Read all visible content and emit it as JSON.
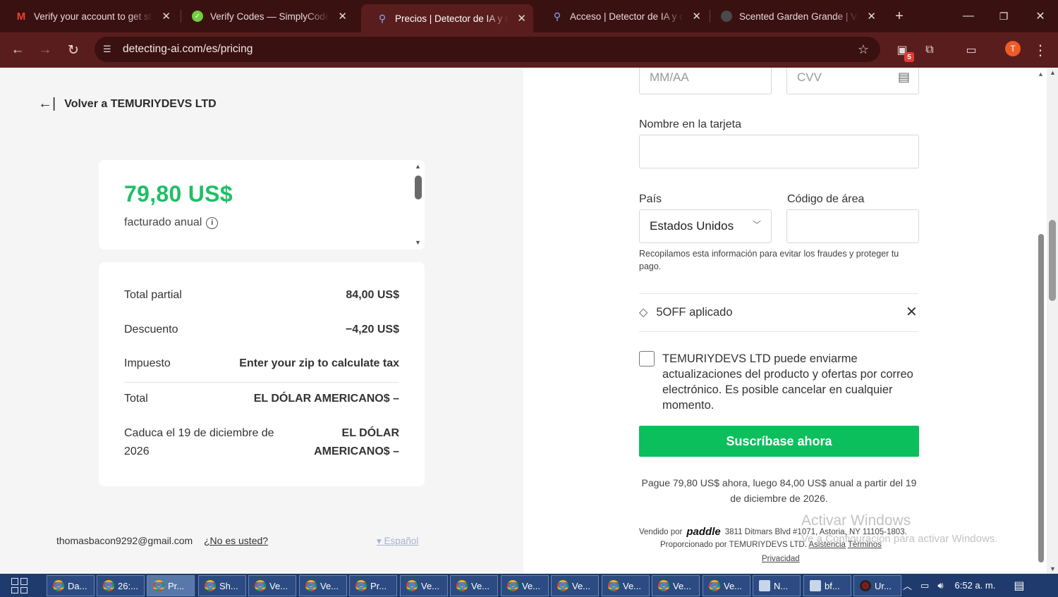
{
  "browser": {
    "tabs": [
      {
        "title": "Verify your account to get sta",
        "icon": "gmail-icon",
        "color": "#d93025"
      },
      {
        "title": "Verify Codes — SimplyCodes",
        "icon": "simplycodes-icon",
        "color": "#6fcf3f"
      },
      {
        "title": "Precios | Detector de IA y con",
        "icon": "search-magnifier-icon",
        "color": "#8aa4ff"
      },
      {
        "title": "Acceso | Detector de IA y con",
        "icon": "search-magnifier-icon",
        "color": "#8aa4ff"
      },
      {
        "title": "Scented Garden Grande | Val",
        "icon": "shop-icon",
        "color": "#4a4a4a"
      }
    ],
    "url": "detecting-ai.com/es/pricing",
    "extension_badge": "5",
    "profile_initial": "T"
  },
  "left": {
    "back_link": "Volver a TEMURIYDEVS LTD",
    "price": "79,80 US$",
    "billed": "facturado anual",
    "summary": [
      {
        "label": "Total partial",
        "value": "84,00 US$"
      },
      {
        "label": "Descuento",
        "value": "−4,20 US$"
      },
      {
        "label": "Impuesto",
        "value": "Enter your zip to calculate tax"
      },
      {
        "label": "Total",
        "value": "EL DÓLAR AMERICANO$ –"
      },
      {
        "label": "Caduca el 19 de diciembre de 2026",
        "value": "EL DÓLAR AMERICANO$ –"
      }
    ],
    "email": "thomasbacon9292@gmail.com",
    "not_you": "¿No es usted?",
    "language": "Español"
  },
  "form": {
    "expiry_placeholder": "MM/AA",
    "cvv_placeholder": "CVV",
    "name_label": "Nombre en la tarjeta",
    "name_value": "",
    "country_label": "País",
    "country_value": "Estados Unidos",
    "zip_label": "Código de área",
    "zip_value": "",
    "note": "Recopilamos esta información para evitar los fraudes y proteger tu pago.",
    "coupon": "5OFF aplicado",
    "optin": "TEMURIYDEVS LTD puede enviarme actualizaciones del producto y ofertas por correo electrónico. Es posible cancelar en cualquier momento.",
    "subscribe": "Suscríbase ahora",
    "pay_note": "Pague 79,80 US$ ahora, luego 84,00 US$ anual a partir del 19 de diciembre de 2026.",
    "sold_by": "Vendido por",
    "brand": "paddle",
    "address": "3811 Ditmars Blvd #1071, Astoria, NY 11105-1803.",
    "provided_by": "Proporcionado por TEMURIYDEVS LTD.",
    "support": "Asistencia",
    "terms": "Términos",
    "privacy": "Privacidad"
  },
  "watermark": {
    "line1": "Activar Windows",
    "line2": "Ve a Configuración para activar Windows."
  },
  "taskbar": {
    "tasks": [
      "Da...",
      "26:...",
      "Pr...",
      "Sh...",
      "Ve...",
      "Ve...",
      "Pr...",
      "Ve...",
      "Ve...",
      "Ve...",
      "Ve...",
      "Ve...",
      "Ve...",
      "Ve...",
      "N...",
      "bf...",
      "Ur..."
    ],
    "time": "6:52 a. m."
  },
  "colors": {
    "accent_green": "#0bbf5c",
    "price_green": "#1fbf66",
    "browser_frame": "#5a1d1d"
  }
}
